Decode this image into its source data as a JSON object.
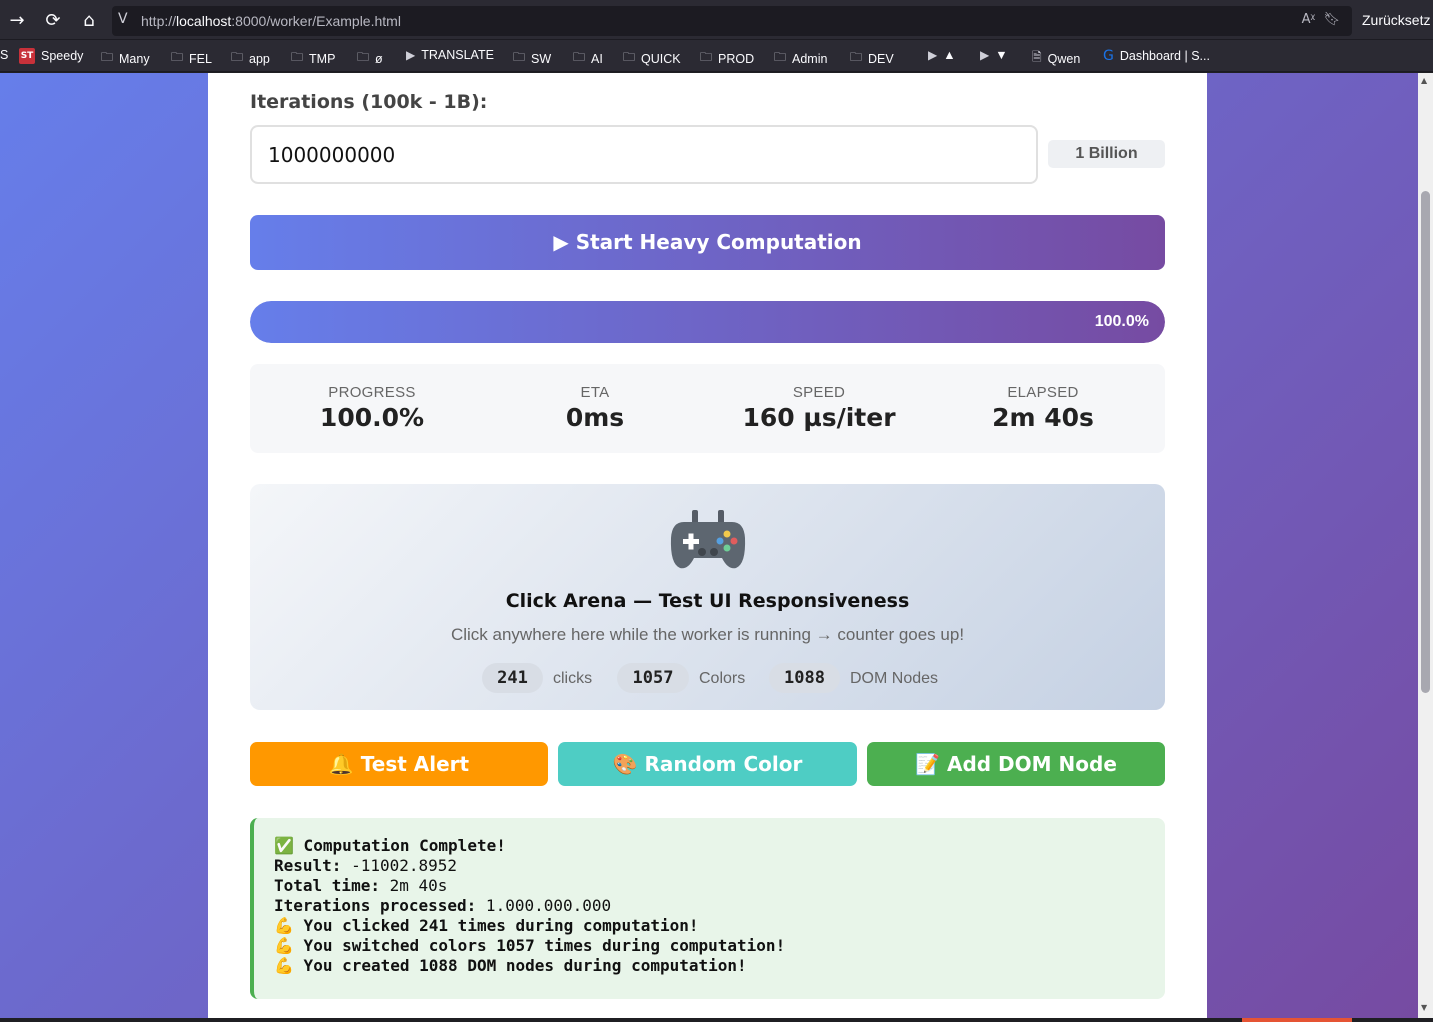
{
  "browser": {
    "url_prefix": "http://",
    "url_host": "localhost",
    "url_rest": ":8000/worker/Example.html",
    "reset_label": "Zurücksetz",
    "bookmarks": [
      {
        "label": "Speedy",
        "icon": "speedtest-icon"
      },
      {
        "label": "Many",
        "icon": "folder-icon"
      },
      {
        "label": "FEL",
        "icon": "folder-icon"
      },
      {
        "label": "app",
        "icon": "folder-icon"
      },
      {
        "label": "TMP",
        "icon": "folder-icon"
      },
      {
        "label": "ø",
        "icon": "folder-icon"
      },
      {
        "label": "TRANSLATE",
        "icon": "page-icon"
      },
      {
        "label": "SW",
        "icon": "folder-icon"
      },
      {
        "label": "AI",
        "icon": "folder-icon"
      },
      {
        "label": "QUICK",
        "icon": "folder-icon"
      },
      {
        "label": "PROD",
        "icon": "folder-icon"
      },
      {
        "label": "Admin",
        "icon": "folder-icon"
      },
      {
        "label": "DEV",
        "icon": "folder-icon"
      },
      {
        "label": "▲",
        "icon": "page-icon"
      },
      {
        "label": "▼",
        "icon": "page-icon"
      },
      {
        "label": "Qwen",
        "icon": "doc-icon"
      },
      {
        "label": "Dashboard | S...",
        "icon": "g-icon"
      }
    ]
  },
  "app": {
    "iterations_label": "Iterations (100k - 1B):",
    "iterations_value": "1000000000",
    "iterations_readable": "1 Billion",
    "start_button": "▶ Start Heavy Computation",
    "progress": {
      "fraction": 1.0,
      "text": "100.0%"
    },
    "stats": [
      {
        "label": "PROGRESS",
        "value": "100.0%"
      },
      {
        "label": "ETA",
        "value": "0ms"
      },
      {
        "label": "SPEED",
        "value": "160 µs/iter"
      },
      {
        "label": "ELAPSED",
        "value": "2m 40s"
      }
    ],
    "arena": {
      "icon": "gamepad-icon",
      "title": "Click Arena — Test UI Responsiveness",
      "subtitle": "Click anywhere here while the worker is running → counter goes up!",
      "counters": [
        {
          "value": "241",
          "label": "clicks"
        },
        {
          "value": "1057",
          "label": "Colors"
        },
        {
          "value": "1088",
          "label": "DOM Nodes"
        }
      ]
    },
    "actions": [
      {
        "label": "🔔 Test Alert",
        "color": "#ff9800"
      },
      {
        "label": "🎨 Random Color",
        "color": "#4ecdc4"
      },
      {
        "label": "📝 Add DOM Node",
        "color": "#4caf50"
      }
    ],
    "result": {
      "title": "✅ Computation Complete!",
      "lines": [
        {
          "key": "Result:",
          "value": " -11002.8952"
        },
        {
          "key": "Total time:",
          "value": " 2m 40s"
        },
        {
          "key": "Iterations processed:",
          "value": " 1.000.000.000"
        }
      ],
      "notes": [
        "💪 You clicked 241 times during computation!",
        "💪 You switched colors 1057 times during computation!",
        "💪 You created 1088 DOM nodes during computation!"
      ]
    }
  }
}
